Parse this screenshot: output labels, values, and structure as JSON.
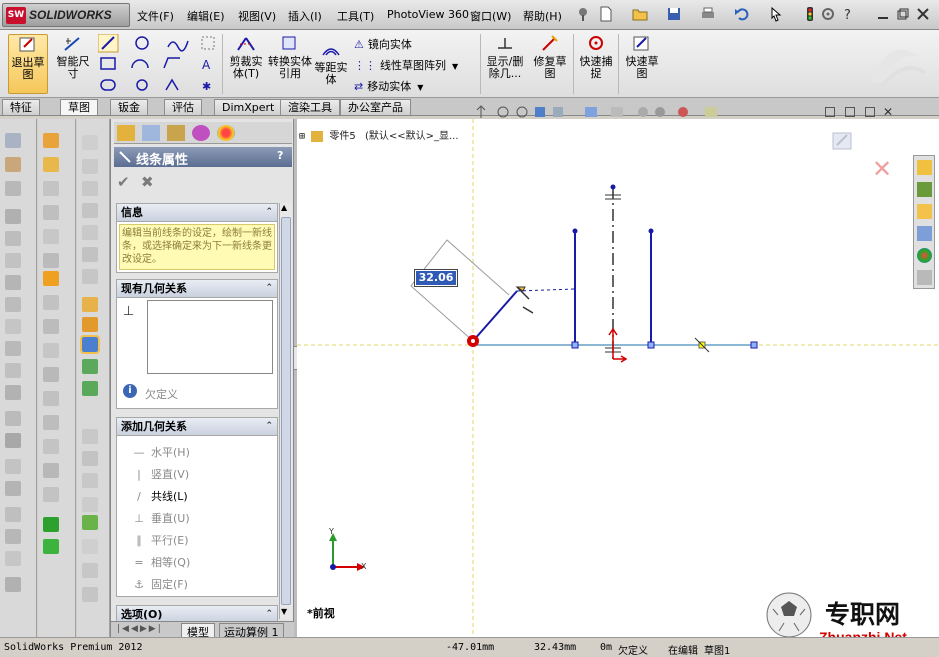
{
  "app": {
    "brand": "SOLIDWORKS",
    "brand_badge": "SW"
  },
  "menus": [
    "文件(F)",
    "编辑(E)",
    "视图(V)",
    "插入(I)",
    "工具(T)",
    "PhotoView 360",
    "窗口(W)",
    "帮助(H)"
  ],
  "ribbon": {
    "exit_sketch": "退出草图",
    "smart_dimension": "智能尺寸",
    "trim_entities": "剪裁实体(T)",
    "convert_entities": "转换实体引用",
    "offset_entities": "等距实体",
    "mirror_entities": "镜向实体",
    "linear_pattern": "线性草图阵列",
    "move_entities": "移动实体",
    "display_delete": "显示/删除几...",
    "repair_sketch": "修复草图",
    "quick_snaps": "快速捕捉",
    "rapid_sketch": "快速草图"
  },
  "tabs": [
    "特征",
    "草图",
    "钣金",
    "评估",
    "DimXpert",
    "渲染工具",
    "办公室产品"
  ],
  "tree": {
    "part_label": "零件5",
    "config_label": "(默认<<默认>_显..."
  },
  "pm": {
    "title": "线条属性",
    "help": "?",
    "info_header": "信息",
    "info_text": "编辑当前线条的设定，绘制一新线条，或选择确定来为下一新线条更改设定。",
    "existing_header": "现有几何关系",
    "under_defined": "欠定义",
    "add_header": "添加几何关系",
    "relations": [
      {
        "icon": "—",
        "label": "水平(H)"
      },
      {
        "icon": "|",
        "label": "竖直(V)"
      },
      {
        "icon": "/",
        "label": "共线(L)"
      },
      {
        "icon": "⊥",
        "label": "垂直(U)"
      },
      {
        "icon": "∥",
        "label": "平行(E)"
      },
      {
        "icon": "=",
        "label": "相等(Q)"
      },
      {
        "icon": "⚓",
        "label": "固定(F)"
      }
    ],
    "options_header": "选项(O)",
    "bottom_tabs": [
      "模型",
      "运动算例 1"
    ]
  },
  "canvas": {
    "dimension_value": "32.06",
    "view_label": "*前视",
    "axis_x": "X",
    "axis_y": "Y"
  },
  "status": {
    "product": "SolidWorks Premium 2012",
    "x": "-47.01mm",
    "y": "32.43mm",
    "z": "0m",
    "state": "欠定义",
    "editing": "在编辑 草图1"
  },
  "watermark": {
    "title": "专职网",
    "url": "Zhuanzhi.Net"
  },
  "colors": {
    "sketch_blue": "#1a1aa8",
    "origin_red": "#d40000",
    "accent": "#c8102e"
  }
}
